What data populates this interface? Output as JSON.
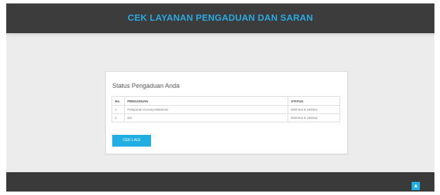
{
  "header": {
    "title": "CEK LAYANAN PENGADUAN DAN SARAN"
  },
  "card": {
    "title": "Status Pengaduan Anda",
    "table": {
      "columns": [
        "No.",
        "PENGADUAN",
        "STATUS"
      ],
      "rows": [
        {
          "no": "1",
          "pengaduan": "Pelayanan Kurang Maksimal",
          "status": "Diterima & Selesai"
        },
        {
          "no": "2",
          "pengaduan": "tes",
          "status": "Diterima & Selesai"
        }
      ]
    },
    "button_label": "CEK LAGI"
  },
  "footer": {
    "scroll_top_icon": "chevron-up-icon",
    "scroll_top_glyph": "▲"
  },
  "colors": {
    "accent": "#21aee3",
    "header_bg": "#3c3c3c",
    "page_bg": "#ececec"
  }
}
